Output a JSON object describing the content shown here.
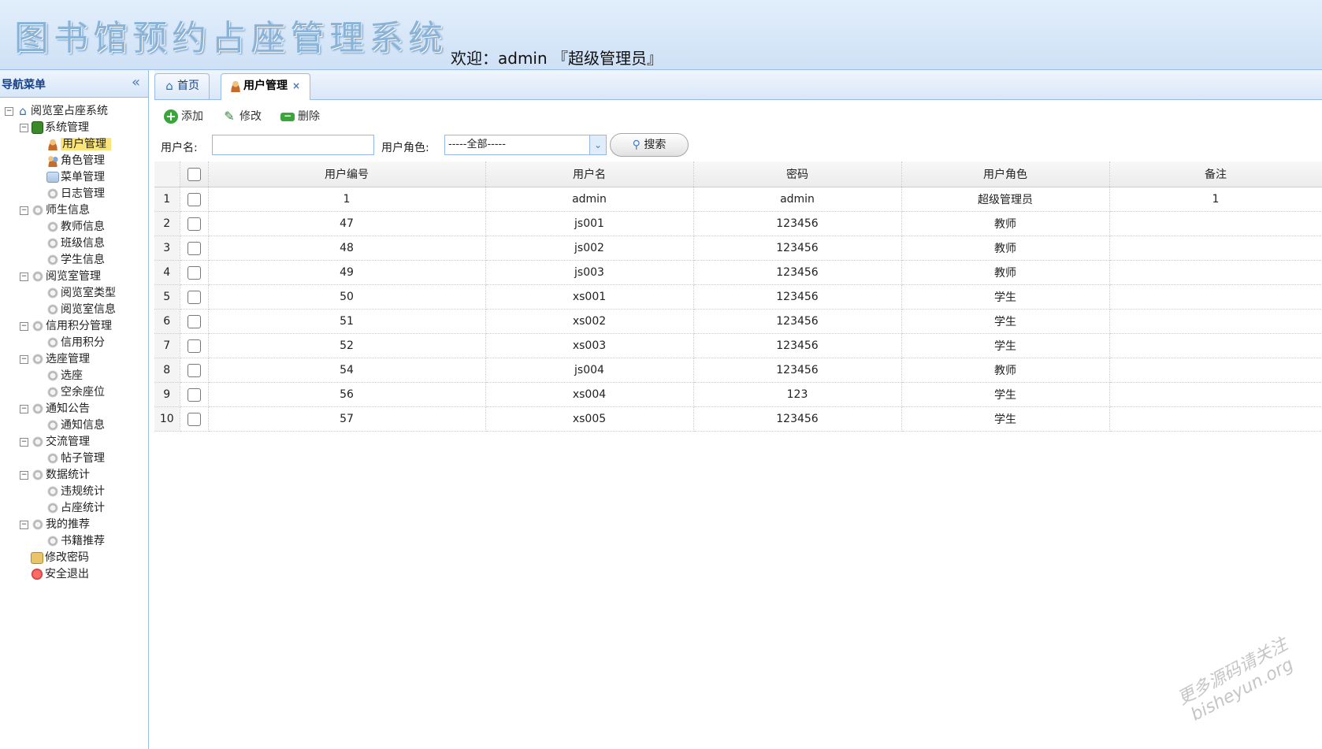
{
  "header": {
    "title": "图书馆预约占座管理系统",
    "welcome": "欢迎：admin 『超级管理员』"
  },
  "sidebar": {
    "title": "导航菜单",
    "collapse_glyph": "«",
    "tree": [
      {
        "label": "阅览室占座系统",
        "icon": "home-icon",
        "level": 0,
        "expander": "−"
      },
      {
        "label": "系统管理",
        "icon": "book-icon",
        "level": 1,
        "expander": "−"
      },
      {
        "label": "用户管理",
        "icon": "user-icon",
        "level": 2,
        "selected": true
      },
      {
        "label": "角色管理",
        "icon": "users-icon",
        "level": 2
      },
      {
        "label": "菜单管理",
        "icon": "menu-icon",
        "level": 2
      },
      {
        "label": "日志管理",
        "icon": "gear-icon",
        "level": 2
      },
      {
        "label": "师生信息",
        "icon": "gear-icon",
        "level": 1,
        "expander": "−"
      },
      {
        "label": "教师信息",
        "icon": "gear-icon",
        "level": 2
      },
      {
        "label": "班级信息",
        "icon": "gear-icon",
        "level": 2
      },
      {
        "label": "学生信息",
        "icon": "gear-icon",
        "level": 2
      },
      {
        "label": "阅览室管理",
        "icon": "gear-icon",
        "level": 1,
        "expander": "−"
      },
      {
        "label": "阅览室类型",
        "icon": "gear-icon",
        "level": 2
      },
      {
        "label": "阅览室信息",
        "icon": "gear-icon",
        "level": 2
      },
      {
        "label": "信用积分管理",
        "icon": "gear-icon",
        "level": 1,
        "expander": "−"
      },
      {
        "label": "信用积分",
        "icon": "gear-icon",
        "level": 2
      },
      {
        "label": "选座管理",
        "icon": "gear-icon",
        "level": 1,
        "expander": "−"
      },
      {
        "label": "选座",
        "icon": "gear-icon",
        "level": 2
      },
      {
        "label": "空余座位",
        "icon": "gear-icon",
        "level": 2
      },
      {
        "label": "通知公告",
        "icon": "gear-icon",
        "level": 1,
        "expander": "−"
      },
      {
        "label": "通知信息",
        "icon": "gear-icon",
        "level": 2
      },
      {
        "label": "交流管理",
        "icon": "gear-icon",
        "level": 1,
        "expander": "−"
      },
      {
        "label": "帖子管理",
        "icon": "gear-icon",
        "level": 2
      },
      {
        "label": "数据统计",
        "icon": "gear-icon",
        "level": 1,
        "expander": "−"
      },
      {
        "label": "违规统计",
        "icon": "gear-icon",
        "level": 2
      },
      {
        "label": "占座统计",
        "icon": "gear-icon",
        "level": 2
      },
      {
        "label": "我的推荐",
        "icon": "gear-icon",
        "level": 1,
        "expander": "−"
      },
      {
        "label": "书籍推荐",
        "icon": "gear-icon",
        "level": 2
      },
      {
        "label": "修改密码",
        "icon": "pen-icon",
        "level": 1
      },
      {
        "label": "安全退出",
        "icon": "exit-icon",
        "level": 1
      }
    ]
  },
  "tabs": [
    {
      "label": "首页",
      "icon": "home-icon",
      "active": false
    },
    {
      "label": "用户管理",
      "icon": "user-icon",
      "active": true,
      "close": "×"
    }
  ],
  "toolbar": {
    "add_label": "添加",
    "edit_label": "修改",
    "delete_label": "删除"
  },
  "search": {
    "username_label": "用户名:",
    "username_value": "",
    "role_label": "用户角色:",
    "role_selected": "-----全部-----",
    "search_label": "搜索"
  },
  "grid": {
    "columns": [
      "用户编号",
      "用户名",
      "密码",
      "用户角色",
      "备注"
    ],
    "rows": [
      {
        "n": "1",
        "id": "1",
        "name": "admin",
        "pwd": "admin",
        "role": "超级管理员",
        "note": "1"
      },
      {
        "n": "2",
        "id": "47",
        "name": "js001",
        "pwd": "123456",
        "role": "教师",
        "note": ""
      },
      {
        "n": "3",
        "id": "48",
        "name": "js002",
        "pwd": "123456",
        "role": "教师",
        "note": ""
      },
      {
        "n": "4",
        "id": "49",
        "name": "js003",
        "pwd": "123456",
        "role": "教师",
        "note": ""
      },
      {
        "n": "5",
        "id": "50",
        "name": "xs001",
        "pwd": "123456",
        "role": "学生",
        "note": ""
      },
      {
        "n": "6",
        "id": "51",
        "name": "xs002",
        "pwd": "123456",
        "role": "学生",
        "note": ""
      },
      {
        "n": "7",
        "id": "52",
        "name": "xs003",
        "pwd": "123456",
        "role": "学生",
        "note": ""
      },
      {
        "n": "8",
        "id": "54",
        "name": "js004",
        "pwd": "123456",
        "role": "教师",
        "note": ""
      },
      {
        "n": "9",
        "id": "56",
        "name": "xs004",
        "pwd": "123",
        "role": "学生",
        "note": ""
      },
      {
        "n": "10",
        "id": "57",
        "name": "xs005",
        "pwd": "123456",
        "role": "学生",
        "note": ""
      }
    ]
  },
  "watermark": {
    "line1": "更多源码请关注",
    "line2": "bisheyun.org"
  }
}
